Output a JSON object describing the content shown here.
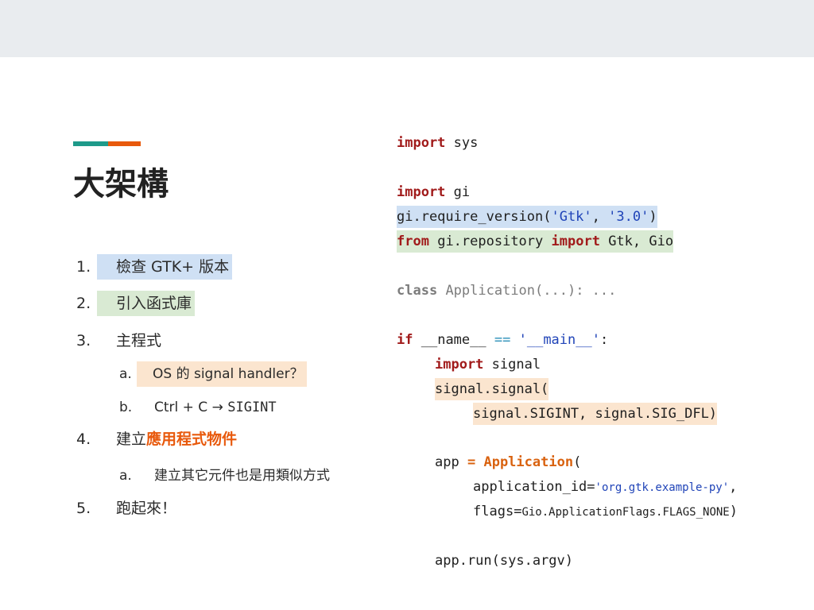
{
  "slide": {
    "title": "大架構",
    "accent_colors": [
      "#1e9a8a",
      "#e8590c"
    ],
    "outline": {
      "item1": {
        "num": "1.",
        "text": "檢查 GTK+ 版本"
      },
      "item2": {
        "num": "2.",
        "text": "引入函式庫"
      },
      "item3": {
        "num": "3.",
        "text": "主程式"
      },
      "item3a": {
        "num": "a.",
        "text": "OS 的 signal handler？"
      },
      "item3b": {
        "num": "b.",
        "text": "Ctrl + C → ",
        "mono": "SIGINT"
      },
      "item4": {
        "num": "4.",
        "text": "建立",
        "accent": "應用程式物件"
      },
      "item4a": {
        "num": "a.",
        "text": "建立其它元件也是用類似方式"
      },
      "item5": {
        "num": "5.",
        "text": "跑起來！"
      }
    },
    "code": {
      "import_kw": "import",
      "sys": "sys",
      "gi": "gi",
      "req_prefix": "gi.require_version(",
      "req_arg1": "'Gtk'",
      "req_sep": ", ",
      "req_arg2": "'3.0'",
      "req_close": ")",
      "from_kw": "from",
      "from_mod": "gi.repository",
      "from_names": "Gtk, Gio",
      "class_kw": "class",
      "class_rest": "Application(...): ...",
      "if_kw": "if",
      "if_name": "__name__",
      "if_eq": "==",
      "if_main": "'__main__'",
      "if_colon": ":",
      "signal": "signal",
      "signal_call": "signal.signal(",
      "signal_args": "signal.SIGINT, signal.SIG_DFL)",
      "app_var": "app",
      "app_eq": "=",
      "app_class": "Application",
      "app_paren": "(",
      "app_id_key": "application_id",
      "app_id_eq": "=",
      "app_id_val": "'org.gtk.example-py'",
      "app_id_comma": ",",
      "flags_key": "flags",
      "flags_eq": "=",
      "flags_val": "Gio.ApplicationFlags.FLAGS_NONE",
      "flags_close": ")",
      "run_call": "app.run(sys.argv)"
    }
  }
}
